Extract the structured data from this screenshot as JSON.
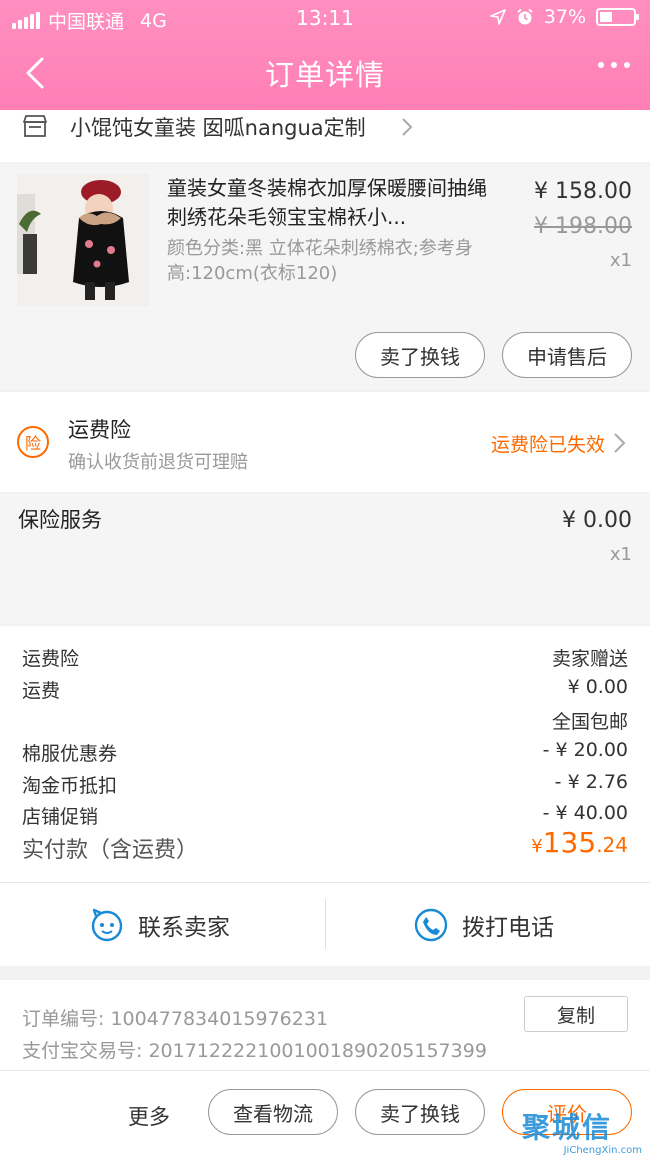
{
  "status_bar": {
    "carrier": "中国联通",
    "network": "4G",
    "time": "13:11",
    "battery": "37%"
  },
  "nav": {
    "title": "订单详情",
    "back_icon": "chevron-left-icon",
    "more_icon": "ellipsis-icon"
  },
  "shop": {
    "name": "小馄饨女童装 囡呱nangua定制",
    "icon": "store-icon"
  },
  "product": {
    "title": "童装女童冬装棉衣加厚保暖腰间抽绳刺绣花朵毛领宝宝棉袄小...",
    "spec": "颜色分类:黑 立体花朵刺绣棉衣;参考身高:120cm(衣标120)",
    "price": "¥ 158.00",
    "original_price": "¥ 198.00",
    "quantity": "x1",
    "buttons": {
      "sell": "卖了换钱",
      "after_sale": "申请售后"
    }
  },
  "insurance": {
    "badge": "险",
    "title": "运费险",
    "subtitle": "确认收货前退货可理赔",
    "status": "运费险已失效"
  },
  "service": {
    "label": "保险服务",
    "price": "¥ 0.00",
    "quantity": "x1"
  },
  "summary": {
    "rows": [
      {
        "label": "运费险",
        "value": "卖家赠送"
      },
      {
        "label": "运费",
        "value": "¥ 0.00"
      },
      {
        "label": "",
        "value": "全国包邮"
      },
      {
        "label": "棉服优惠券",
        "value": "- ¥ 20.00"
      },
      {
        "label": "淘金币抵扣",
        "value": "- ¥ 2.76"
      },
      {
        "label": "店铺促销",
        "value": "- ¥ 40.00"
      }
    ],
    "total_label": "实付款（含运费）",
    "total_symbol": "¥",
    "total_int": "135",
    "total_dec": ".24"
  },
  "contact": {
    "seller": "联系卖家",
    "phone": "拨打电话"
  },
  "order_info": {
    "order_no": "订单编号:  100477834015976231",
    "alipay_no": "支付宝交易号:  2017122221001001890205157399",
    "copy": "复制"
  },
  "bottom": {
    "more": "更多",
    "logistics": "查看物流",
    "sell": "卖了换钱",
    "review": "评价"
  },
  "watermark": {
    "text": "聚城信",
    "url": "JiChengXin.com"
  },
  "colors": {
    "header": "#ff85b8",
    "accent": "#ff6a00",
    "link_blue": "#1a8ad6"
  }
}
